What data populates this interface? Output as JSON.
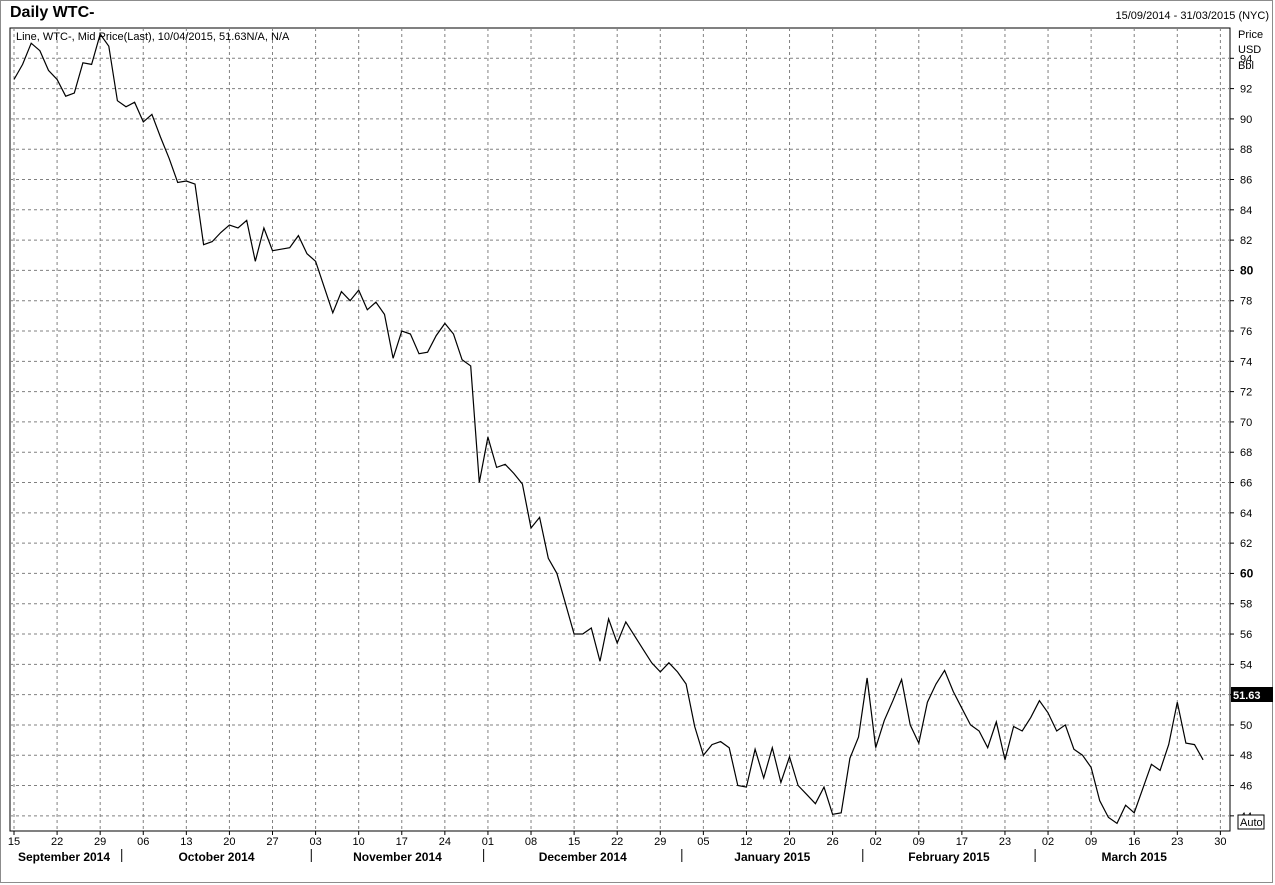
{
  "header": {
    "title": "Daily WTC-",
    "date_range": "15/09/2014 - 31/03/2015 (NYC)",
    "series_desc": "Line, WTC-, Mid Price(Last), 10/04/2015, 51.63N/A, N/A"
  },
  "axis": {
    "unit_lines": [
      "Price",
      "USD",
      "Bbl"
    ],
    "auto_label": "Auto",
    "last_value_label": "51.63"
  },
  "colors": {
    "line": "#000000",
    "grid": "#808080",
    "last_value_bg": "#000000",
    "last_value_fg": "#ffffff"
  },
  "chart_data": {
    "type": "line",
    "title": "Daily WTC-",
    "ylim": [
      43,
      96
    ],
    "grid": true,
    "yticks": [
      44,
      46,
      48,
      50,
      52,
      54,
      56,
      58,
      60,
      62,
      64,
      66,
      68,
      70,
      72,
      74,
      76,
      78,
      80,
      82,
      84,
      86,
      88,
      90,
      92,
      94
    ],
    "ytick_bold": [
      60,
      80
    ],
    "x_day_ticks": [
      {
        "label": "15",
        "i": 0
      },
      {
        "label": "22",
        "i": 5
      },
      {
        "label": "29",
        "i": 10
      },
      {
        "label": "06",
        "i": 15
      },
      {
        "label": "13",
        "i": 20
      },
      {
        "label": "20",
        "i": 25
      },
      {
        "label": "27",
        "i": 30
      },
      {
        "label": "03",
        "i": 35
      },
      {
        "label": "10",
        "i": 40
      },
      {
        "label": "17",
        "i": 45
      },
      {
        "label": "24",
        "i": 50
      },
      {
        "label": "01",
        "i": 55
      },
      {
        "label": "08",
        "i": 60
      },
      {
        "label": "15",
        "i": 65
      },
      {
        "label": "22",
        "i": 70
      },
      {
        "label": "29",
        "i": 75
      },
      {
        "label": "05",
        "i": 80
      },
      {
        "label": "12",
        "i": 85
      },
      {
        "label": "20",
        "i": 90
      },
      {
        "label": "26",
        "i": 95
      },
      {
        "label": "02",
        "i": 100
      },
      {
        "label": "09",
        "i": 105
      },
      {
        "label": "17",
        "i": 110
      },
      {
        "label": "23",
        "i": 115
      },
      {
        "label": "02",
        "i": 120
      },
      {
        "label": "09",
        "i": 125
      },
      {
        "label": "16",
        "i": 130
      },
      {
        "label": "23",
        "i": 135
      },
      {
        "label": "30",
        "i": 140
      }
    ],
    "months": [
      {
        "label": "September 2014",
        "start": 0,
        "end": 12.5
      },
      {
        "label": "October 2014",
        "start": 12.5,
        "end": 34.5
      },
      {
        "label": "November 2014",
        "start": 34.5,
        "end": 54.5
      },
      {
        "label": "December 2014",
        "start": 54.5,
        "end": 77.5
      },
      {
        "label": "January 2015",
        "start": 77.5,
        "end": 98.5
      },
      {
        "label": "February 2015",
        "start": 98.5,
        "end": 118.5
      },
      {
        "label": "March 2015",
        "start": 118.5,
        "end": 141.5
      }
    ],
    "n_points": 142,
    "series": [
      {
        "values": [
          92.6,
          93.6,
          95.0,
          94.5,
          93.2,
          92.6,
          91.5,
          91.7,
          93.7,
          93.6,
          95.6,
          94.8,
          91.2,
          90.8,
          91.1,
          89.8,
          90.3,
          88.8,
          87.4,
          85.8,
          85.9,
          85.7,
          81.7,
          81.9,
          82.5,
          83.0,
          82.8,
          83.3,
          80.6,
          82.8,
          81.3,
          81.4,
          81.5,
          82.3,
          81.1,
          80.6,
          78.9,
          77.2,
          78.6,
          78.0,
          78.7,
          77.4,
          77.9,
          77.1,
          74.2,
          76.0,
          75.8,
          74.5,
          74.6,
          75.7,
          76.5,
          75.8,
          74.1,
          73.7,
          66.0,
          69.0,
          67.0,
          67.2,
          66.6,
          65.9,
          63.0,
          63.7,
          61.0,
          60.0,
          58.0,
          56.0,
          56.0,
          56.4,
          54.2,
          57.0,
          55.4,
          56.8,
          55.9,
          55.0,
          54.1,
          53.5,
          54.1,
          53.5,
          52.7,
          49.9,
          48.0,
          48.7,
          48.9,
          48.5,
          46.0,
          45.9,
          48.4,
          46.5,
          48.5,
          46.2,
          47.9,
          46.0,
          45.4,
          44.8,
          45.9,
          44.1,
          44.2,
          47.8,
          49.2,
          53.1,
          48.5,
          50.3,
          51.6,
          53.0,
          50.0,
          48.8,
          51.5,
          52.7,
          53.6,
          52.2,
          51.1,
          50.0,
          49.6,
          48.5,
          50.2,
          47.7,
          49.9,
          49.6,
          50.5,
          51.6,
          50.8,
          49.6,
          50.0,
          48.4,
          48.0,
          47.2,
          45.0,
          43.9,
          43.5,
          44.7,
          44.2,
          45.8,
          47.4,
          47.0,
          48.7,
          51.5,
          48.8,
          48.7,
          47.7
        ]
      }
    ]
  }
}
